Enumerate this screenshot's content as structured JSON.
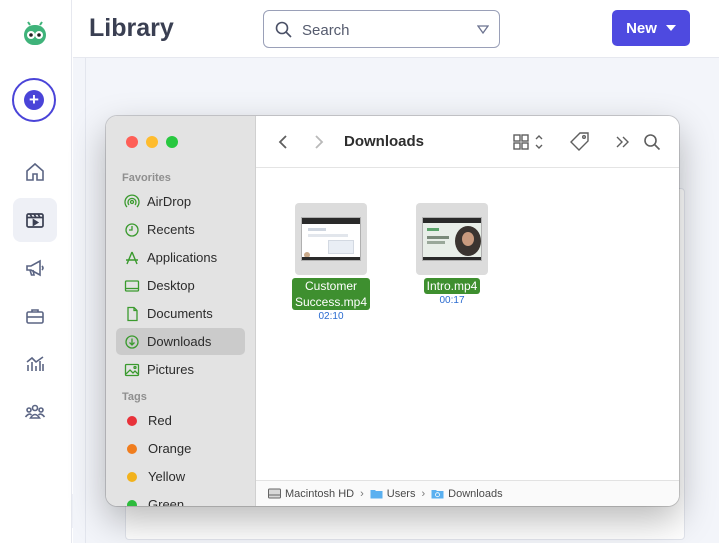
{
  "header": {
    "title": "Library",
    "search_placeholder": "Search",
    "new_label": "New"
  },
  "rail": {
    "items": [
      "home-icon",
      "library-icon",
      "megaphone-icon",
      "briefcase-icon",
      "analytics-icon",
      "team-icon"
    ],
    "active": "library-icon"
  },
  "colors": {
    "accent": "#4e4ae0",
    "selected_file_label": "#3e8f2f",
    "duration_text": "#2a6bd0"
  },
  "finder": {
    "title": "Downloads",
    "favorites_label": "Favorites",
    "favorites": [
      {
        "label": "AirDrop",
        "icon": "airdrop-icon"
      },
      {
        "label": "Recents",
        "icon": "clock-icon"
      },
      {
        "label": "Applications",
        "icon": "applications-icon"
      },
      {
        "label": "Desktop",
        "icon": "desktop-icon"
      },
      {
        "label": "Documents",
        "icon": "document-icon"
      },
      {
        "label": "Downloads",
        "icon": "download-icon"
      },
      {
        "label": "Pictures",
        "icon": "pictures-icon"
      }
    ],
    "tags_label": "Tags",
    "tags": [
      {
        "label": "Red",
        "color": "#e8323a"
      },
      {
        "label": "Orange",
        "color": "#f07d1e"
      },
      {
        "label": "Yellow",
        "color": "#f2b21c"
      },
      {
        "label": "Green",
        "color": "#2dbb3c"
      }
    ],
    "files": [
      {
        "name_line1": "Customer",
        "name_line2": "Success.mp4",
        "duration": "02:10"
      },
      {
        "name_line1": "Intro.mp4",
        "name_line2": "",
        "duration": "00:17"
      }
    ],
    "path": [
      "Macintosh HD",
      "Users",
      "Downloads"
    ]
  }
}
